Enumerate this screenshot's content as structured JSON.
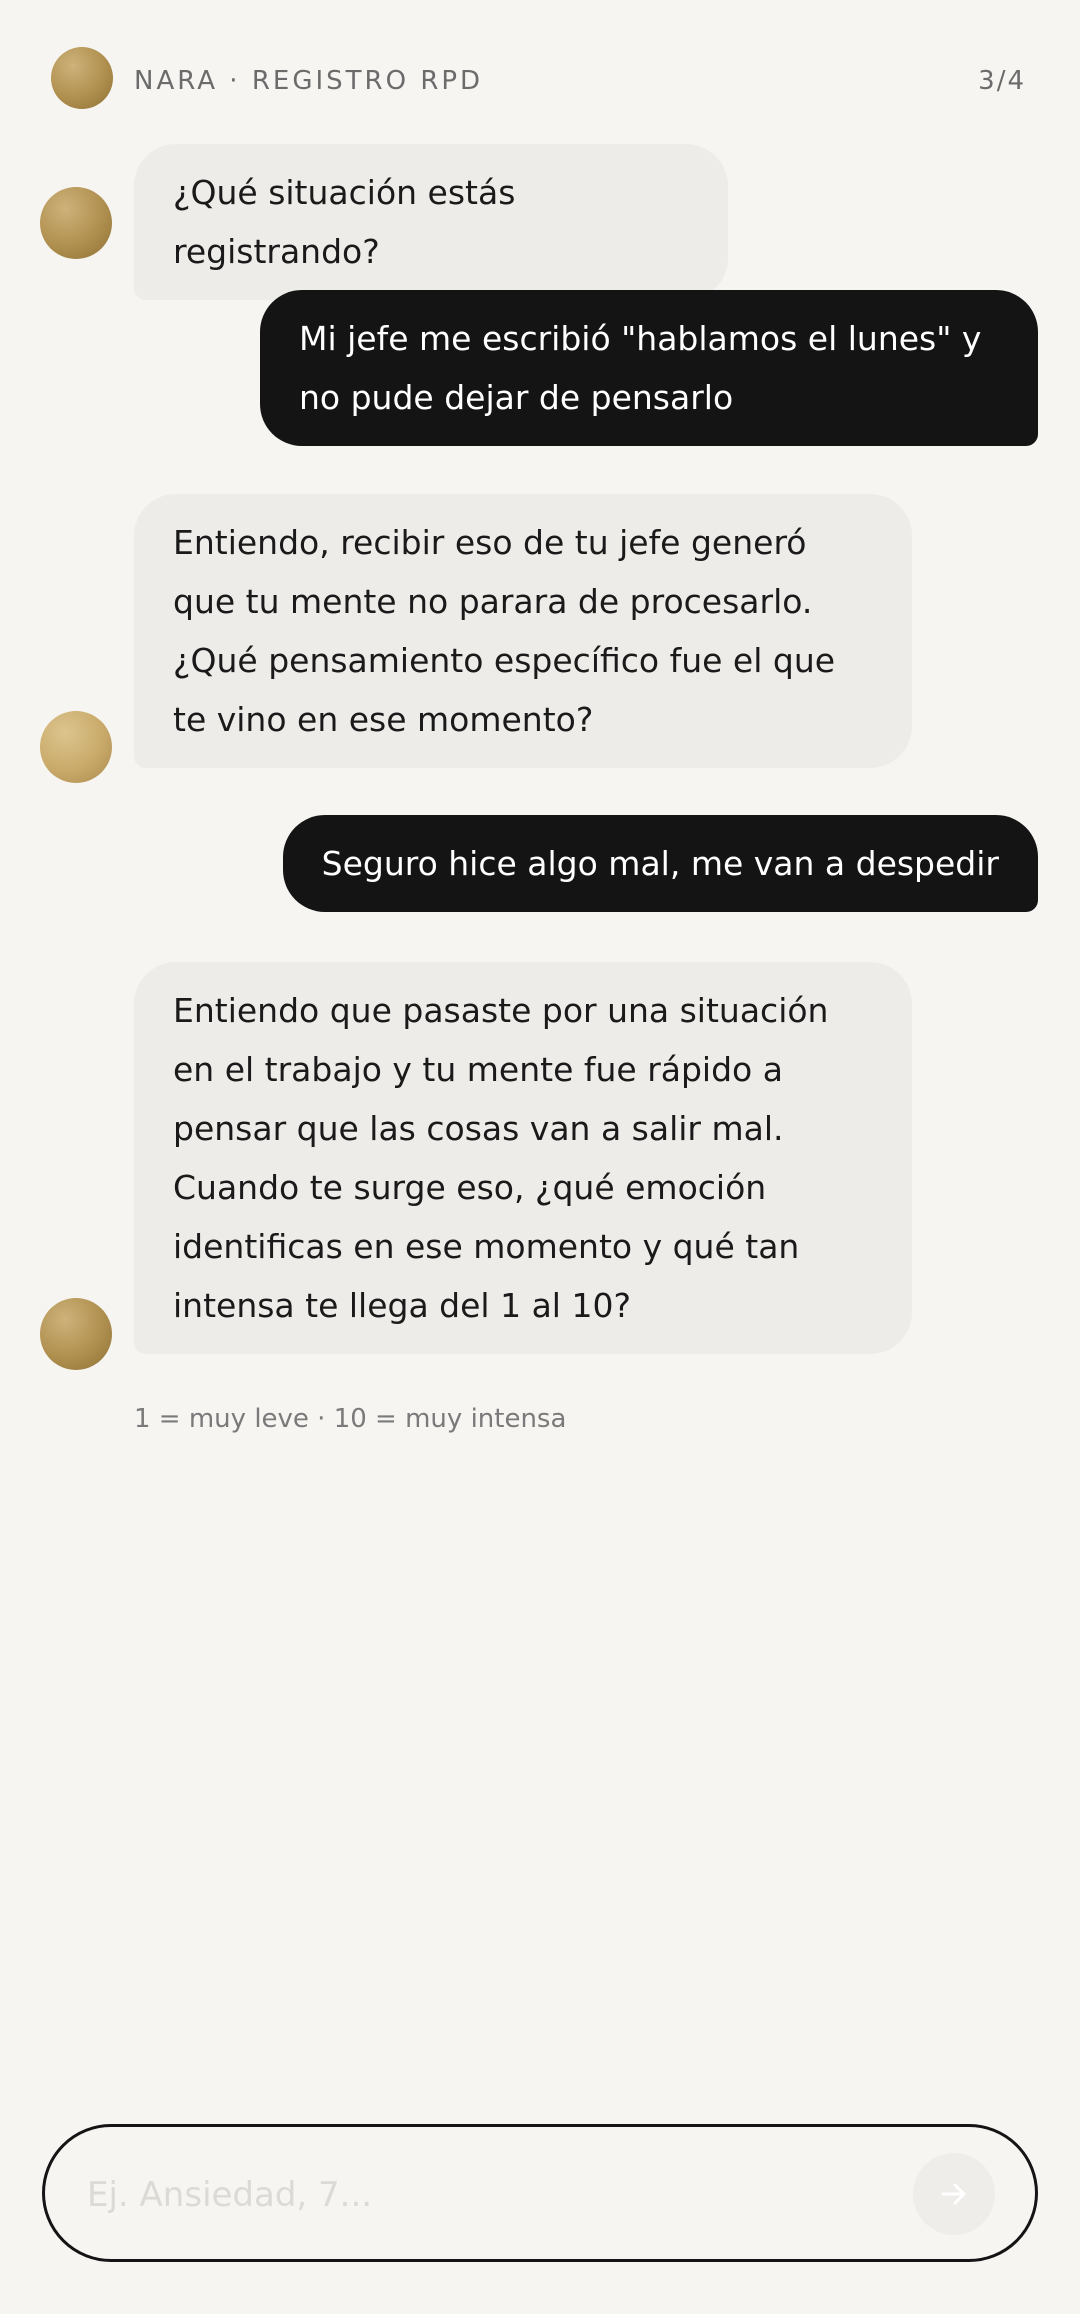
{
  "header": {
    "title": "NARA · REGISTRO RPD",
    "step": "3/4"
  },
  "messages": [
    {
      "role": "bot",
      "text": "¿Qué situación estás registrando?"
    },
    {
      "role": "user",
      "text": "Mi jefe me escribió \"hablamos el lunes\" y no pude dejar de pensarlo"
    },
    {
      "role": "bot",
      "text": "Entiendo, recibir eso de tu jefe generó que tu mente no parara de procesarlo. ¿Qué pensamiento específico fue el que te vino en ese momento?"
    },
    {
      "role": "user",
      "text": "Seguro hice algo mal, me van a despedir"
    },
    {
      "role": "bot",
      "text": "Entiendo que pasaste por una situación en el trabajo y tu mente fue rápido a pensar que las cosas van a salir mal. Cuando te surge eso, ¿qué emoción identificas en ese momento y qué tan intensa te llega del 1 al 10?"
    }
  ],
  "scale_hint": "1 = muy leve · 10 = muy intensa",
  "composer": {
    "value": "",
    "placeholder": "Ej. Ansiedad, 7..."
  },
  "icons": {
    "avatar": "nara-avatar",
    "send": "arrow-right-icon"
  }
}
